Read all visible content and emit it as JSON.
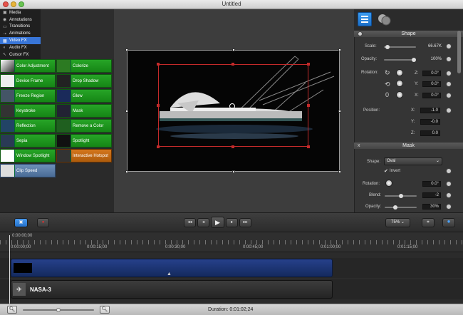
{
  "window": {
    "title": "Untitled"
  },
  "categories": [
    {
      "label": "Media",
      "icon": "media-icon",
      "selected": false
    },
    {
      "label": "Annotations",
      "icon": "annotations-icon",
      "selected": false
    },
    {
      "label": "Transitions",
      "icon": "transitions-icon",
      "selected": false
    },
    {
      "label": "Animations",
      "icon": "animations-icon",
      "selected": false
    },
    {
      "label": "Video FX",
      "icon": "video-fx-icon",
      "selected": true
    },
    {
      "label": "Audio FX",
      "icon": "audio-fx-icon",
      "selected": false
    },
    {
      "label": "Cursor FX",
      "icon": "cursor-fx-icon",
      "selected": false
    }
  ],
  "effects": [
    {
      "label": "Color Adjustment",
      "color": "green"
    },
    {
      "label": "Colorize",
      "color": "green"
    },
    {
      "label": "Device Frame",
      "color": "green"
    },
    {
      "label": "Drop Shadow",
      "color": "green"
    },
    {
      "label": "Freeze Region",
      "color": "green"
    },
    {
      "label": "Glow",
      "color": "green"
    },
    {
      "label": "Keystroke",
      "color": "green"
    },
    {
      "label": "Mask",
      "color": "green"
    },
    {
      "label": "Reflection",
      "color": "green"
    },
    {
      "label": "Remove a Color",
      "color": "green"
    },
    {
      "label": "Sepia",
      "color": "green"
    },
    {
      "label": "Spotlight",
      "color": "green"
    },
    {
      "label": "Window Spotlight",
      "color": "green"
    },
    {
      "label": "Interactive Hotspot",
      "color": "orange"
    },
    {
      "label": "Clip Speed",
      "color": "blue"
    }
  ],
  "inspector": {
    "shape": {
      "title": "Shape",
      "scale_label": "Scale:",
      "scale_value": "66.67K",
      "scale_fraction": 0.05,
      "opacity_label": "Opacity:",
      "opacity_value": "100%",
      "opacity_fraction": 1.0,
      "rotation_label": "Rotation:",
      "rot_z_label": "Z:",
      "rot_z_value": "0.0°",
      "rot_y_label": "Y:",
      "rot_y_value": "0.0°",
      "rot_x_label": "X:",
      "rot_x_value": "0.0°",
      "position_label": "Position:",
      "pos_x_label": "X:",
      "pos_x_value": "-1.0",
      "pos_y_label": "Y:",
      "pos_y_value": "-0.0",
      "pos_z_label": "Z:",
      "pos_z_value": "0.0"
    },
    "mask": {
      "title": "Mask",
      "close_label": "x",
      "shape_label": "Shape:",
      "shape_value": "Oval",
      "invert_label": "Invert",
      "invert_checked": true,
      "rotation_label": "Rotation:",
      "rotation_value": "0.0°",
      "blend_label": "Blend:",
      "blend_value": "-2",
      "blend_fraction": 0.5,
      "opacity_label": "Opacity:",
      "opacity_value": "30%",
      "opacity_fraction": 0.3
    }
  },
  "toolbar": {
    "zoom_value": "75%"
  },
  "timeline": {
    "timecode": "0:00:00;00",
    "ticks": [
      "0:00:00;00",
      "0:00:15;00",
      "0:00:30;00",
      "0:00:45;00",
      "0:01:00;00",
      "0:01:15;00"
    ],
    "clip_media_name": "NASA-3"
  },
  "status": {
    "duration_label": "Duration: 0:01:02;24"
  }
}
